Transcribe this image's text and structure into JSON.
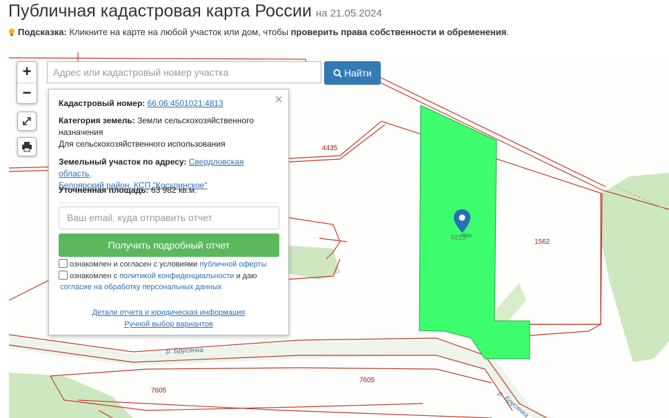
{
  "header": {
    "title": "Публичная кадастровая карта России",
    "date": "на 21.05.2024"
  },
  "hint": {
    "label": "Подсказка:",
    "text": " Кликните на карте на любой участок или дом, чтобы ",
    "bold_text": "проверить права собственности и обременения",
    "end": "."
  },
  "controls": {
    "zoom_in": "+",
    "zoom_out": "−",
    "fullscreen_icon": "expand-icon",
    "print_icon": "printer-icon"
  },
  "search": {
    "placeholder": "Адрес или кадастровый номер участка",
    "button_label": "Найти",
    "button_icon": "search-icon"
  },
  "popup": {
    "cadastral_label": "Кадастровый номер:",
    "cadastral_value": "66:06:4501021:4813",
    "category_label": "Категория земель:",
    "category_value": "Земли сельскохозяйственного",
    "category_value_2": "назначения",
    "usage": "Для сельскохозяйственного использования",
    "address_label": "Земельный участок по адресу:",
    "address_value_1": "Свердловская область,",
    "address_value_2": "Белоярский район, КСП \"Косулинское\"",
    "area_label": "Уточненная площадь:",
    "area_value": "63 982 кв.м.",
    "email_placeholder": "Ваш email, куда отправить отчет",
    "report_button": "Получить подробный отчет",
    "consent1_text": "ознакомлен и согласен с условиями ",
    "consent1_link": "публичной оферты",
    "consent2_text": "ознакомлен с ",
    "consent2_link": "политикой конфиденциальности",
    "consent2_text2": " и даю",
    "consent2_link2": "согласие на обработку персональных данных",
    "details_link": "Детали отчета и юридическая информация",
    "manual_link": "Ручной выбор вариантов",
    "close": "×"
  },
  "map_labels": {
    "parcel_4435": "4435",
    "parcel_4813": "4813",
    "parcel_1562": "1562",
    "parcel_7605a": "7605",
    "parcel_7605b": "7605",
    "river_1": "р. Брусянка",
    "river_2": "р. Брусянка"
  },
  "colors": {
    "parcel_highlight": "#3dff6e",
    "parcel_border": "#c0392b",
    "button_primary": "#337ab7",
    "button_success": "#5cb85c",
    "link": "#2a6eb5"
  }
}
